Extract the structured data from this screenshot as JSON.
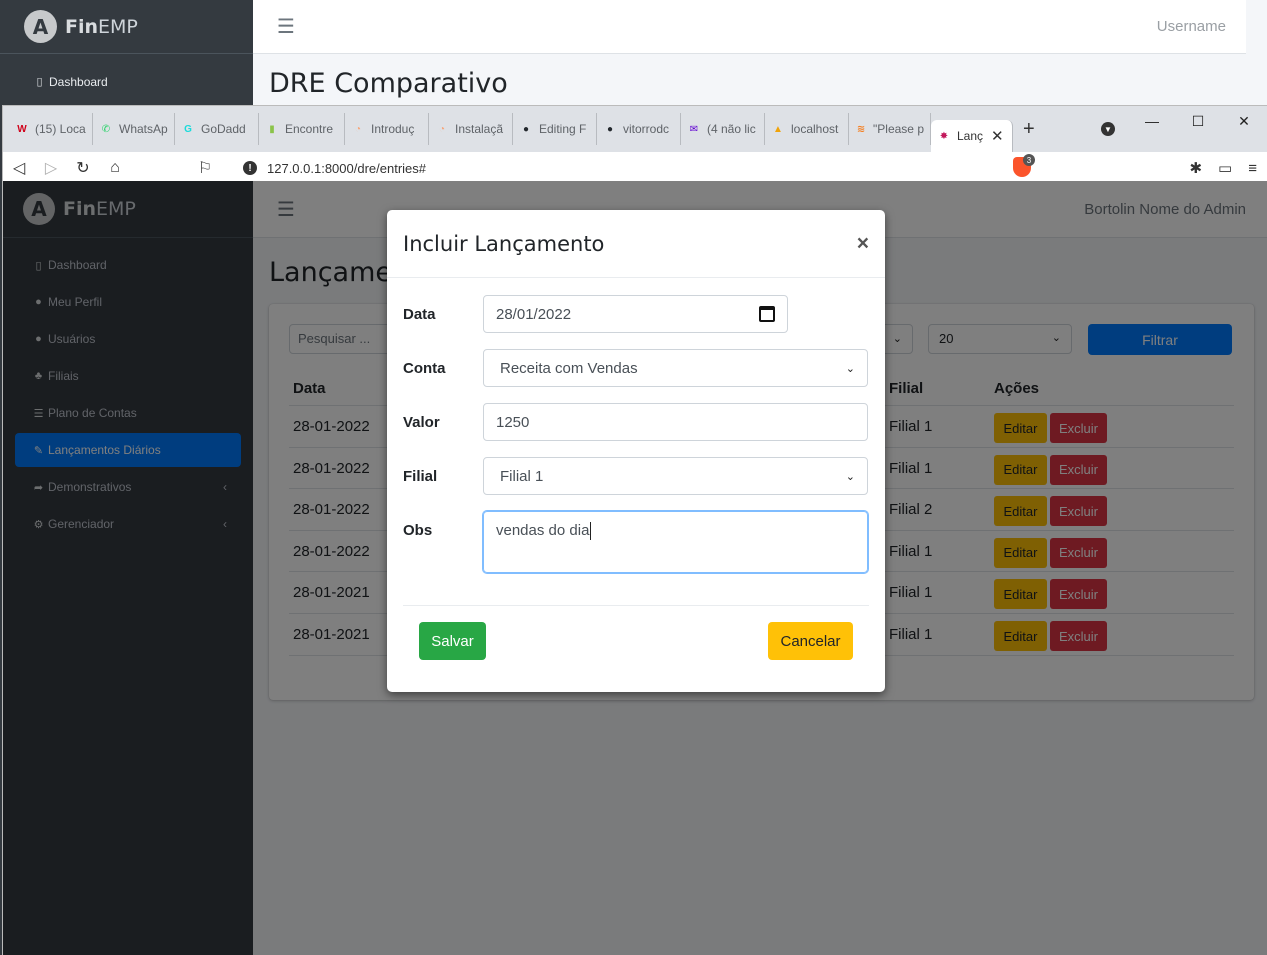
{
  "background_app": {
    "brand_bold": "Fin",
    "brand_rest": "EMP",
    "nav_item": "Dashboard",
    "username": "Username",
    "page_title": "DRE Comparativo"
  },
  "browser": {
    "tabs": [
      {
        "label": "(15) Loca",
        "favicon": "W",
        "fav_color": "#d0021b"
      },
      {
        "label": "WhatsAp",
        "favicon": "✆",
        "fav_color": "#25d366"
      },
      {
        "label": "GoDadd",
        "favicon": "G",
        "fav_color": "#1bdbdb"
      },
      {
        "label": "Encontre",
        "favicon": "▮",
        "fav_color": "#8bc34a"
      },
      {
        "label": "Introduç",
        "favicon": "◔",
        "fav_color": "#f6a77d"
      },
      {
        "label": "Instalaçã",
        "favicon": "◔",
        "fav_color": "#f6a77d"
      },
      {
        "label": "Editing F",
        "favicon": "●",
        "fav_color": "#24292e"
      },
      {
        "label": "vitorrodc",
        "favicon": "●",
        "fav_color": "#24292e"
      },
      {
        "label": "(4 não lic",
        "favicon": "✉",
        "fav_color": "#6001d2"
      },
      {
        "label": "localhost",
        "favicon": "▲",
        "fav_color": "#f0a30a"
      },
      {
        "label": "\"Please p",
        "favicon": "≋",
        "fav_color": "#f48024"
      }
    ],
    "active_tab": {
      "label": "Lanç",
      "favicon": "✸",
      "fav_color": "#c2185b"
    },
    "url": "127.0.0.1:8000/dre/entries#",
    "brave_badge": "3"
  },
  "app": {
    "brand_bold": "Fin",
    "brand_rest": "EMP",
    "admin_name": "Bortolin Nome do Admin",
    "sidebar": [
      {
        "label": "Dashboard",
        "icon": "▯",
        "active": false
      },
      {
        "label": "Meu Perfil",
        "icon": "●",
        "active": false
      },
      {
        "label": "Usuários",
        "icon": "●",
        "active": false
      },
      {
        "label": "Filiais",
        "icon": "♣",
        "active": false
      },
      {
        "label": "Plano de Contas",
        "icon": "☰",
        "active": false
      },
      {
        "label": "Lançamentos Diários",
        "icon": "✎",
        "active": true
      },
      {
        "label": "Demonstrativos",
        "icon": "➦",
        "active": false,
        "submenu": true
      },
      {
        "label": "Gerenciador",
        "icon": "⚙",
        "active": false,
        "submenu": true
      }
    ],
    "content_title": "Lançamentos Diários",
    "search_placeholder": "Pesquisar ...",
    "per_page": "20",
    "filter_button": "Filtrar",
    "table": {
      "headers": {
        "date": "Data",
        "filial": "Filial",
        "actions": "Ações"
      },
      "rows": [
        {
          "date": "28-01-2022",
          "filial": "Filial 1"
        },
        {
          "date": "28-01-2022",
          "filial": "Filial 1"
        },
        {
          "date": "28-01-2022",
          "filial": "Filial 2"
        },
        {
          "date": "28-01-2022",
          "filial": "Filial 1"
        },
        {
          "date": "28-01-2021",
          "filial": "Filial 1"
        },
        {
          "date": "28-01-2021",
          "filial": "Filial 1"
        }
      ],
      "edit_label": "Editar",
      "delete_label": "Excluir"
    }
  },
  "modal": {
    "title": "Incluir Lançamento",
    "close": "×",
    "fields": {
      "data_label": "Data",
      "data_value": "28/01/2022",
      "conta_label": "Conta",
      "conta_value": "Receita com Vendas",
      "valor_label": "Valor",
      "valor_value": "1250",
      "filial_label": "Filial",
      "filial_value": "Filial 1",
      "obs_label": "Obs",
      "obs_value": "vendas do dia"
    },
    "save_label": "Salvar",
    "cancel_label": "Cancelar"
  }
}
